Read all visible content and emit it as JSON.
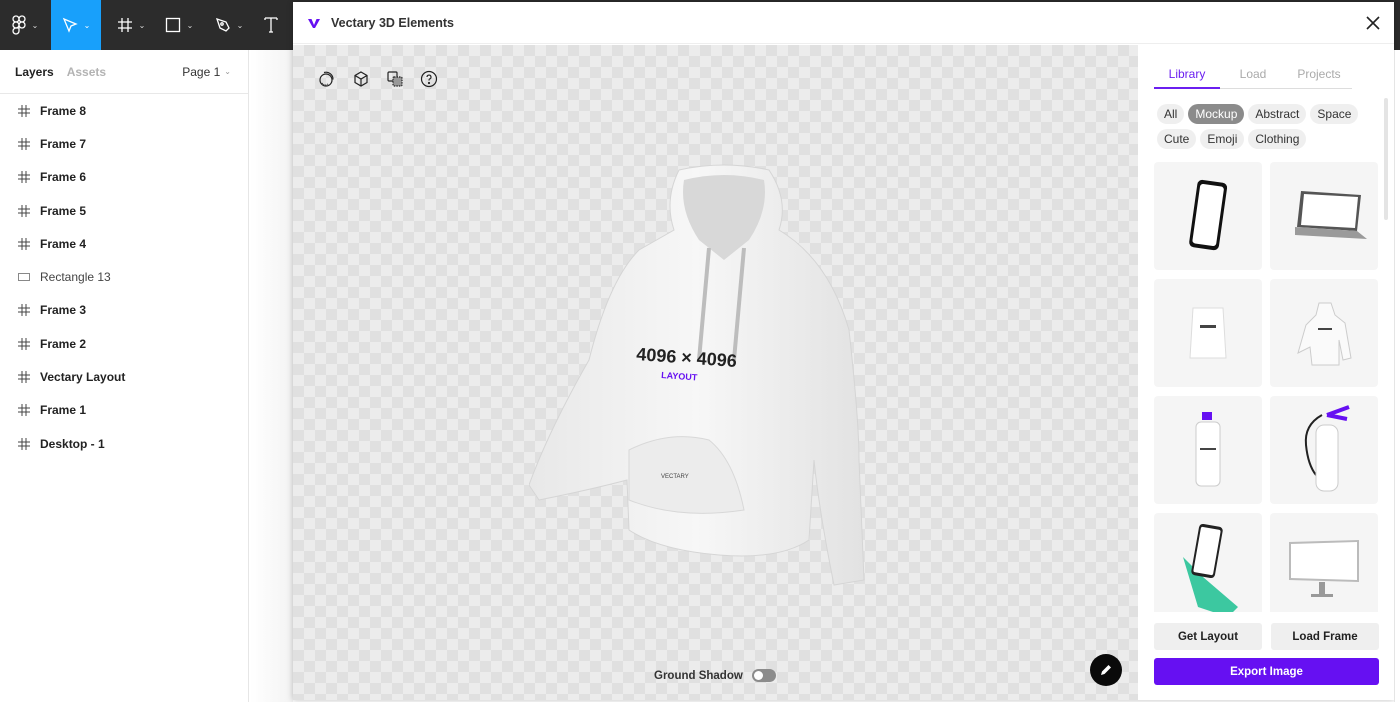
{
  "toolbar": {
    "tools": [
      {
        "name": "main-menu",
        "icon": "figma-logo-icon",
        "active": false
      },
      {
        "name": "move",
        "icon": "cursor-arrow-icon",
        "active": true
      },
      {
        "name": "frame",
        "icon": "frame-hash-icon",
        "active": false
      },
      {
        "name": "shape",
        "icon": "rectangle-icon",
        "active": false
      },
      {
        "name": "pen",
        "icon": "pen-icon",
        "active": false
      },
      {
        "name": "text",
        "icon": "text-icon",
        "active": false
      }
    ],
    "accent": "#18a0fb"
  },
  "left_panel": {
    "tabs": [
      "Layers",
      "Assets"
    ],
    "active_tab": "Layers",
    "page_selector": "Page 1",
    "layers": [
      {
        "label": "Frame 8",
        "type": "frame"
      },
      {
        "label": "Frame 7",
        "type": "frame"
      },
      {
        "label": "Frame 6",
        "type": "frame"
      },
      {
        "label": "Frame 5",
        "type": "frame"
      },
      {
        "label": "Frame 4",
        "type": "frame"
      },
      {
        "label": "Rectangle 13",
        "type": "rectangle"
      },
      {
        "label": "Frame 3",
        "type": "frame"
      },
      {
        "label": "Frame 2",
        "type": "frame"
      },
      {
        "label": "Vectary Layout",
        "type": "frame"
      },
      {
        "label": "Frame 1",
        "type": "frame"
      },
      {
        "label": "Desktop - 1",
        "type": "frame"
      }
    ]
  },
  "plugin": {
    "title": "Vectary 3D Elements",
    "brand_color": "#6610f2",
    "viewport": {
      "tool_icons": [
        "orbit-icon",
        "cube-icon",
        "layers-copy-icon",
        "help-icon"
      ],
      "model": {
        "type": "hoodie",
        "print_text": "4096 × 4096",
        "print_subtext": "LAYOUT",
        "pocket_text": "VECTARY"
      },
      "ground_shadow_label": "Ground Shadow",
      "ground_shadow_on": false
    },
    "sidebar": {
      "tabs": [
        "Library",
        "Load",
        "Projects"
      ],
      "active_tab": "Library",
      "filters": [
        "All",
        "Mockup",
        "Abstract",
        "Space",
        "Cute",
        "Emoji",
        "Clothing"
      ],
      "active_filter": "Mockup",
      "items": [
        {
          "name": "phone"
        },
        {
          "name": "laptop"
        },
        {
          "name": "pouch-bag"
        },
        {
          "name": "hoodie"
        },
        {
          "name": "spray-can"
        },
        {
          "name": "fire-extinguisher"
        },
        {
          "name": "phone-in-hand"
        },
        {
          "name": "monitor"
        }
      ],
      "buttons": {
        "get_layout": "Get Layout",
        "load_frame": "Load Frame",
        "export_image": "Export Image"
      }
    }
  }
}
